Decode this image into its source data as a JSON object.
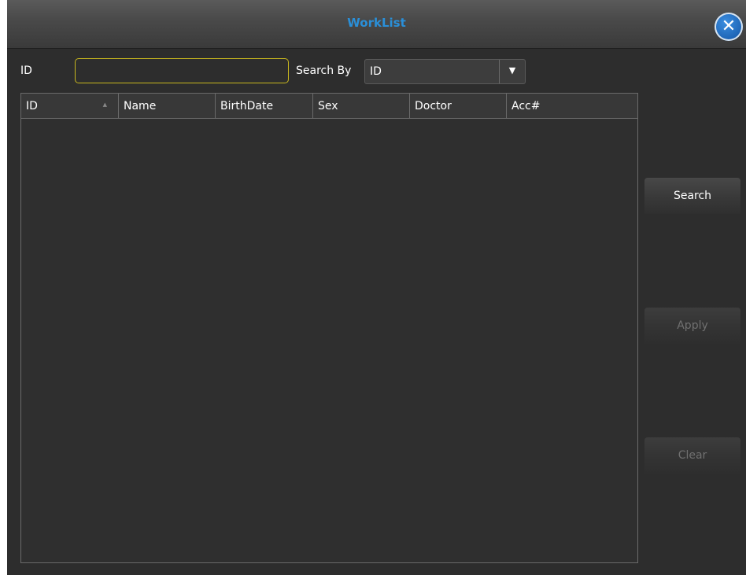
{
  "window": {
    "title": "WorkList"
  },
  "search_row": {
    "id_label": "ID",
    "id_value": "",
    "search_by_label": "Search By",
    "search_by_selected": "ID",
    "dropdown_arrow": "▼"
  },
  "table": {
    "columns": [
      "ID",
      "Name",
      "BirthDate",
      "Sex",
      "Doctor",
      "Acc#"
    ],
    "sorted_column": "ID",
    "sort_direction": "ascending",
    "rows": []
  },
  "buttons": {
    "search": {
      "label": "Search",
      "enabled": true
    },
    "apply": {
      "label": "Apply",
      "enabled": false
    },
    "clear": {
      "label": "Clear",
      "enabled": false
    }
  },
  "icons": {
    "close": "close-icon",
    "sort": "sort-ascending-icon",
    "dropdown": "chevron-down-icon"
  },
  "colors": {
    "title": "#2a8fd8",
    "input_focus_border": "#c8b71e",
    "background": "#2d2d2d",
    "close_button": "#1d63b4"
  }
}
